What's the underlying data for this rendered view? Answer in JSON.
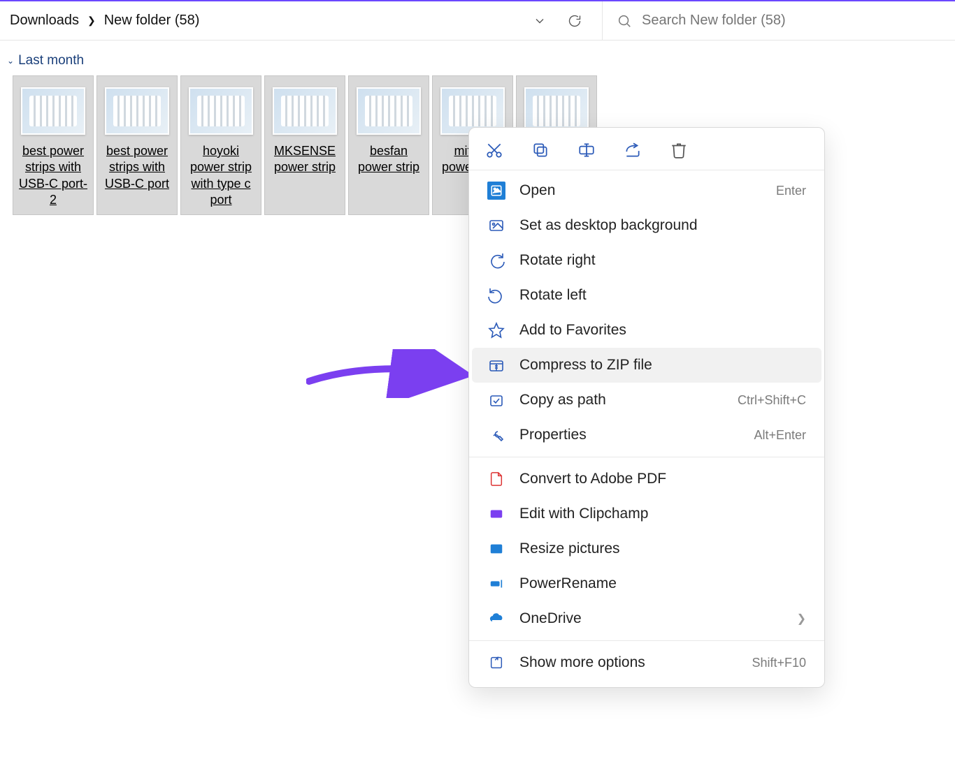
{
  "breadcrumb": {
    "root": "Downloads",
    "current": "New folder (58)"
  },
  "search": {
    "placeholder": "Search New folder (58)"
  },
  "group": {
    "label": "Last month"
  },
  "files": [
    {
      "name": "best power strips with USB-C port-2"
    },
    {
      "name": "best power strips with USB-C port"
    },
    {
      "name": "hoyoki power strip with type c port"
    },
    {
      "name": "MKSENSE power strip"
    },
    {
      "name": "besfan power strip"
    },
    {
      "name": "mifaso power strip"
    },
    {
      "name": ""
    }
  ],
  "ctx": {
    "open": {
      "label": "Open",
      "shortcut": "Enter"
    },
    "setbg": {
      "label": "Set as desktop background"
    },
    "rotright": {
      "label": "Rotate right"
    },
    "rotleft": {
      "label": "Rotate left"
    },
    "fav": {
      "label": "Add to Favorites"
    },
    "zip": {
      "label": "Compress to ZIP file"
    },
    "copypath": {
      "label": "Copy as path",
      "shortcut": "Ctrl+Shift+C"
    },
    "props": {
      "label": "Properties",
      "shortcut": "Alt+Enter"
    },
    "adobe": {
      "label": "Convert to Adobe PDF"
    },
    "clipchamp": {
      "label": "Edit with Clipchamp"
    },
    "resize": {
      "label": "Resize pictures"
    },
    "rename": {
      "label": "PowerRename"
    },
    "onedrive": {
      "label": "OneDrive"
    },
    "more": {
      "label": "Show more options",
      "shortcut": "Shift+F10"
    }
  }
}
